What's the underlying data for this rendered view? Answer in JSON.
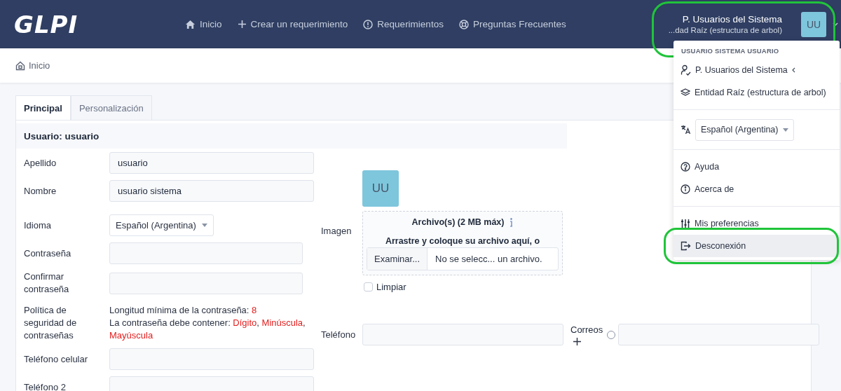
{
  "header": {
    "logo": "GLPI",
    "nav": [
      {
        "label": "Inicio"
      },
      {
        "label": "Crear un requerimiento"
      },
      {
        "label": "Requerimientos"
      },
      {
        "label": "Preguntas Frecuentes"
      }
    ],
    "user": {
      "profile": "P. Usuarios del Sistema",
      "entity": "...dad Raíz (estructura de arbol)",
      "avatar": "UU",
      "highlighted": true
    }
  },
  "breadcrumb": [
    {
      "label": "Inicio"
    }
  ],
  "tabs": [
    {
      "label": "Principal",
      "selected": true
    },
    {
      "label": "Personalización",
      "selected": false
    }
  ],
  "form": {
    "title": "Usuario: usuario",
    "fields": [
      {
        "kind": "text",
        "label": "Apellido",
        "value": "usuario"
      },
      {
        "kind": "text",
        "label": "Nombre",
        "value": "usuario sistema"
      },
      {
        "kind": "select",
        "label": "Idioma",
        "value": "Español (Argentina)"
      },
      {
        "kind": "password",
        "label": "Contraseña"
      },
      {
        "kind": "password",
        "label": "Confirmar contraseña"
      },
      {
        "kind": "policy",
        "label": "Política de seguridad de contraseñas",
        "min_length_label": "Longitud mínima de la contraseña:",
        "min_length": "8",
        "contains_label": "La contraseña debe contener:",
        "requirements": [
          {
            "text": "Dígito",
            "trail": ","
          },
          {
            "text": "Minúscula",
            "trail": ","
          },
          {
            "text": "Mayúscula"
          }
        ]
      },
      {
        "kind": "text",
        "label": "Teléfono celular"
      },
      {
        "kind": "text",
        "label": "Teléfono 2"
      }
    ],
    "image": {
      "label": "Imagen",
      "avatar": "UU",
      "dropzone_title": "Archivo(s) (2 MB máx)",
      "dropzone_hint": "Arrastre y coloque su archivo aquí, o",
      "browse_button": "Examinar...",
      "file_status": "No se selecc... un archivo.",
      "clear": {
        "label": "Limpiar",
        "checked": false
      }
    },
    "phone": {
      "label": "Teléfono"
    },
    "emails": {
      "label": "Correos",
      "default_selected": false
    }
  },
  "menu": {
    "heading": "USUARIO SISTEMA USUARIO",
    "items": [
      {
        "kind": "link",
        "label": "P. Usuarios del Sistema",
        "submenu": true,
        "hovered": false,
        "highlighted": false
      },
      {
        "kind": "link",
        "label": "Entidad Raíz (estructura de arbol)",
        "submenu": false,
        "hovered": false,
        "highlighted": false
      },
      {
        "kind": "divider"
      },
      {
        "kind": "select",
        "label": "Español (Argentina)"
      },
      {
        "kind": "divider"
      },
      {
        "kind": "link",
        "label": "Ayuda",
        "submenu": false,
        "hovered": false,
        "highlighted": false
      },
      {
        "kind": "link",
        "label": "Acerca de",
        "submenu": false,
        "hovered": false,
        "highlighted": false
      },
      {
        "kind": "divider"
      },
      {
        "kind": "link",
        "label": "Mis preferencias",
        "submenu": false,
        "hovered": false,
        "highlighted": false
      },
      {
        "kind": "link",
        "label": "Desconexión",
        "submenu": false,
        "hovered": true,
        "highlighted": true
      }
    ]
  }
}
